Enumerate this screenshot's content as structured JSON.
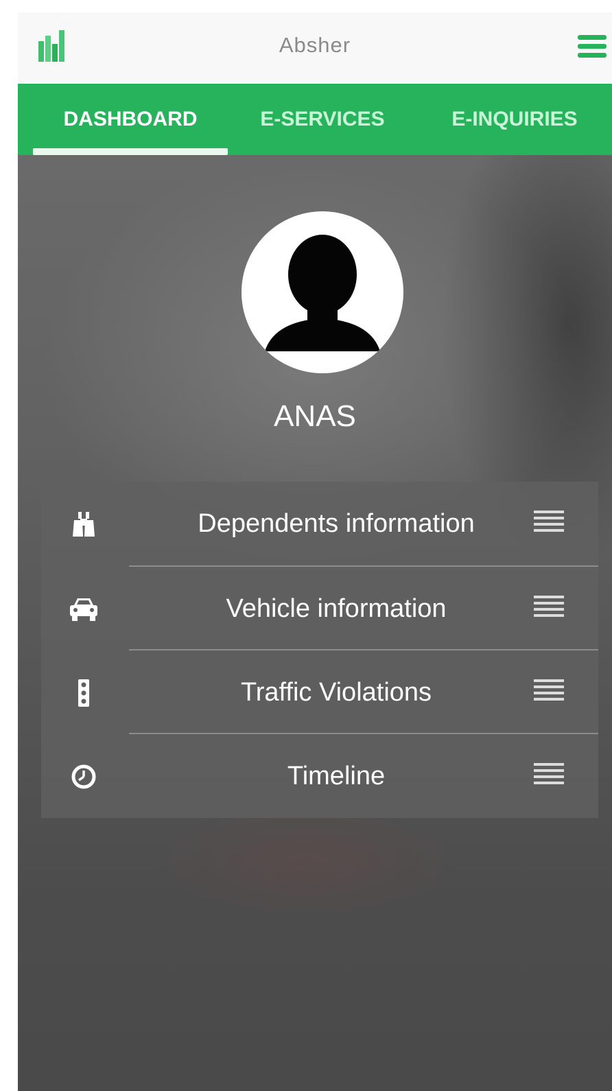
{
  "app": {
    "title": "Absher",
    "logo_icon": "absher-logo-icon",
    "menu_icon": "hamburger-menu-icon",
    "accent_color": "#27b35c"
  },
  "tabs": [
    {
      "label": "DASHBOARD",
      "active": true
    },
    {
      "label": "E-SERVICES",
      "active": false
    },
    {
      "label": "E-INQUIRIES",
      "active": false
    }
  ],
  "profile": {
    "name": "ANAS",
    "avatar_icon": "user-silhouette-icon"
  },
  "menu_items": [
    {
      "label": "Dependents information",
      "icon": "binoculars-icon"
    },
    {
      "label": "Vehicle information",
      "icon": "car-icon"
    },
    {
      "label": "Traffic Violations",
      "icon": "traffic-light-icon"
    },
    {
      "label": "Timeline",
      "icon": "clock-icon"
    }
  ]
}
